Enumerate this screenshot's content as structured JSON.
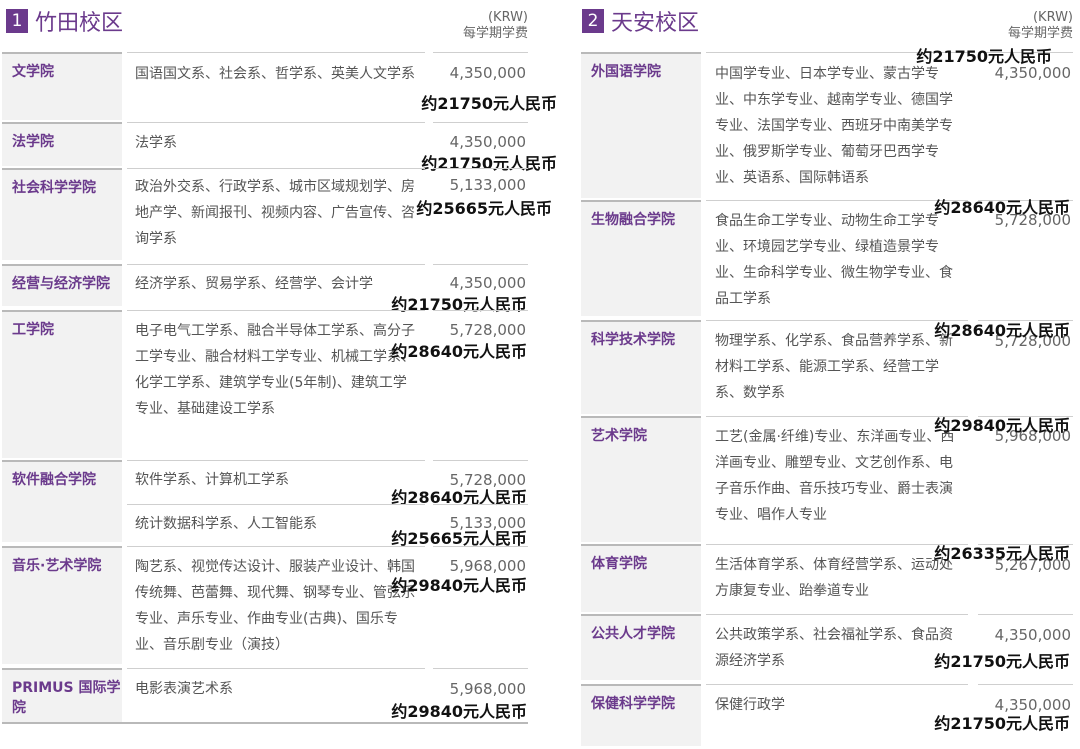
{
  "left": {
    "num": "1",
    "name": "竹田校区",
    "currency_code": "(KRW)",
    "currency_label": "每学期学费",
    "rows": [
      {
        "college": "文学院",
        "majors": "国语国文系、社会系、哲学系、英美人文学系",
        "fee": "4,350,000",
        "rmb": "约21750元人民币"
      },
      {
        "college": "法学院",
        "majors": "法学系",
        "fee": "4,350,000",
        "rmb": "约21750元人民币"
      },
      {
        "college": "社会科学学院",
        "majors": "政治外交系、行政学系、城市区域规划学、房地产学、新闻报刊、视频内容、广告宣传、咨询学系",
        "fee": "5,133,000",
        "rmb": "约25665元人民币"
      },
      {
        "college": "经营与经济学院",
        "majors": "经济学系、贸易学系、经营学、会计学",
        "fee": "4,350,000",
        "rmb": "约21750元人民币"
      },
      {
        "college": "工学院",
        "majors": "电子电气工学系、融合半导体工学系、高分子工学专业、融合材料工学专业、机械工学系、化学工学系、建筑学专业(5年制)、建筑工学专业、基础建设工学系",
        "fee": "5,728,000",
        "rmb": "约28640元人民币"
      },
      {
        "college": "软件融合学院",
        "majors": "软件学系、计算机工学系",
        "fee": "5,728,000",
        "rmb": "约28640元人民币"
      },
      {
        "college": "",
        "majors": "统计数据科学系、人工智能系",
        "fee": "5,133,000",
        "rmb": "约25665元人民币"
      },
      {
        "college": "音乐·艺术学院",
        "majors": "陶艺系、视觉传达设计、服装产业设计、韩国传统舞、芭蕾舞、现代舞、钢琴专业、管弦乐专业、声乐专业、作曲专业(古典)、国乐专业、音乐剧专业（演技）",
        "fee": "5,968,000",
        "rmb": "约29840元人民币"
      },
      {
        "college": "PRIMUS 国际学院",
        "majors": "电影表演艺术系",
        "fee": "5,968,000",
        "rmb": "约29840元人民币"
      }
    ]
  },
  "right": {
    "num": "2",
    "name": "天安校区",
    "currency_code": "(KRW)",
    "currency_label": "每学期学费",
    "rows": [
      {
        "college": "外国语学院",
        "majors": "中国学专业、日本学专业、蒙古学专业、中东学专业、越南学专业、德国学专业、法国学专业、西班牙中南美学专业、俄罗斯学专业、葡萄牙巴西学专业、英语系、国际韩语系",
        "fee": "4,350,000",
        "rmb": "约21750元人民币"
      },
      {
        "college": "生物融合学院",
        "majors": "食品生命工学专业、动物生命工学专业、环境园艺学专业、绿植造景学专业、生命科学专业、微生物学专业、食品工学系",
        "fee": "5,728,000",
        "rmb": "约28640元人民币"
      },
      {
        "college": "科学技术学院",
        "majors": "物理学系、化学系、食品营养学系、新材料工学系、能源工学系、经营工学系、数学系",
        "fee": "5,728,000",
        "rmb": "约28640元人民币"
      },
      {
        "college": "艺术学院",
        "majors": "工艺(金属·纤维)专业、东洋画专业、西洋画专业、雕塑专业、文艺创作系、电子音乐作曲、音乐技巧专业、爵士表演专业、唱作人专业",
        "fee": "5,968,000",
        "rmb": "约29840元人民币"
      },
      {
        "college": "体育学院",
        "majors": "生活体育学系、体育经营学系、运动处方康复专业、跆拳道专业",
        "fee": "5,267,000",
        "rmb": "约26335元人民币"
      },
      {
        "college": "公共人才学院",
        "majors": "公共政策学系、社会福祉学系、食品资源经济学系",
        "fee": "4,350,000",
        "rmb": "约21750元人民币"
      },
      {
        "college": "保健科学学院",
        "majors": "保健行政学",
        "fee": "4,350,000",
        "rmb": "约21750元人民币"
      }
    ]
  }
}
